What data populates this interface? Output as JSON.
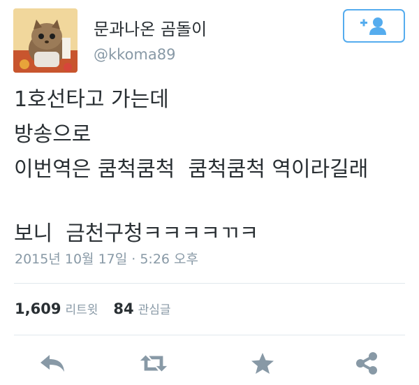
{
  "user": {
    "display_name": "문과나온 곰돌이",
    "handle": "@kkoma89"
  },
  "follow_button": {
    "icon": "follow-plus-person-icon"
  },
  "tweet": {
    "lines": [
      "1호선타고 가는데",
      "방송으로",
      "이번역은 쿰척쿰척  쿰척쿰척 역이라길래",
      "",
      "보니  금천구청ㅋㅋㅋㅋㄲㅋ"
    ],
    "timestamp": "2015년 10월 17일 · 5:26 오후"
  },
  "stats": {
    "retweets_count": "1,609",
    "retweets_label": "리트윗",
    "likes_count": "84",
    "likes_label": "관심글"
  },
  "actions": [
    "reply-icon",
    "retweet-icon",
    "favorite-star-icon",
    "share-icon"
  ],
  "colors": {
    "brand_blue": "#55acee",
    "text": "#292f33",
    "muted": "#8899a6",
    "divider": "#e1e8ed",
    "icon_gray": "#8899a6"
  }
}
